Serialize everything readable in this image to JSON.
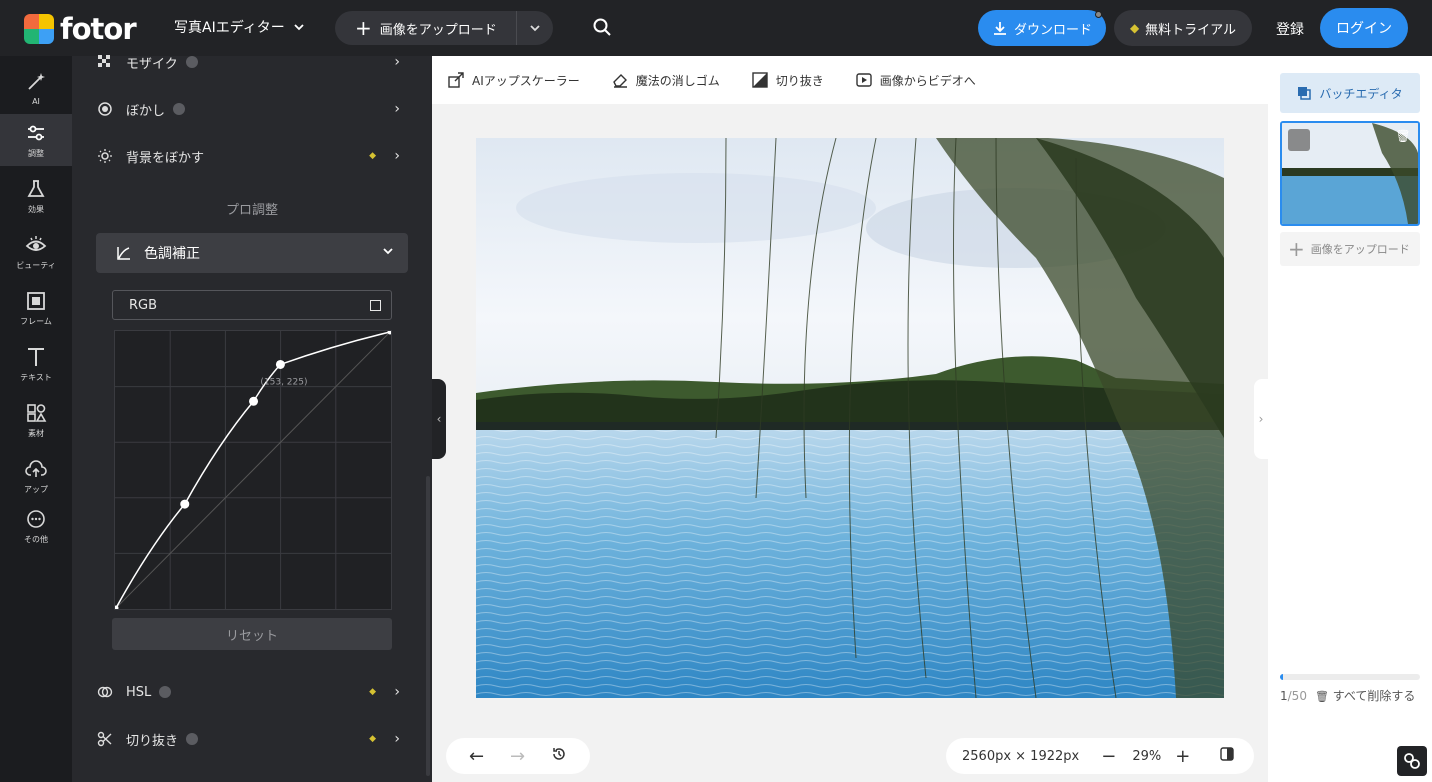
{
  "header": {
    "logo_text": "fotor",
    "editor_label": "写真AIエディター",
    "upload_label": "画像をアップロード",
    "download_label": "ダウンロード",
    "trial_label": "無料トライアル",
    "register_label": "登録",
    "login_label": "ログイン"
  },
  "rail": {
    "items": [
      {
        "label": "AI",
        "icon": "ai-sparkle-icon"
      },
      {
        "label": "調整",
        "icon": "sliders-icon",
        "active": true
      },
      {
        "label": "効果",
        "icon": "flask-icon"
      },
      {
        "label": "ビューティ",
        "icon": "eye-icon"
      },
      {
        "label": "フレーム",
        "icon": "frame-icon"
      },
      {
        "label": "テキスト",
        "icon": "text-icon"
      },
      {
        "label": "素材",
        "icon": "elements-icon"
      },
      {
        "label": "アップ",
        "icon": "cloud-upload-icon"
      },
      {
        "label": "その他",
        "icon": "more-icon"
      }
    ]
  },
  "panel": {
    "mosaic": "モザイク",
    "blur": "ぼかし",
    "bg_blur": "背景をぼかす",
    "pro_section": "プロ調整",
    "curves": "色調補正",
    "channel": "RGB",
    "point_label": "(153, 225)",
    "reset": "リセット",
    "hsl": "HSL",
    "crop": "切り抜き"
  },
  "curve": {
    "points": [
      [
        0,
        0
      ],
      [
        64,
        64
      ],
      [
        128,
        128
      ],
      [
        153,
        225
      ],
      [
        255,
        255
      ]
    ],
    "curve_points": [
      [
        0,
        0
      ],
      [
        64,
        96
      ],
      [
        128,
        191
      ],
      [
        153,
        225
      ],
      [
        255,
        255
      ]
    ]
  },
  "workspace": {
    "tools": [
      {
        "label": "AIアップスケーラー",
        "icon": "upscale-icon"
      },
      {
        "label": "魔法の消しゴム",
        "icon": "eraser-icon"
      },
      {
        "label": "切り抜き",
        "icon": "cutout-icon"
      },
      {
        "label": "画像からビデオへ",
        "icon": "video-icon"
      }
    ],
    "dimensions": "2560px × 1922px",
    "zoom": "29%"
  },
  "right": {
    "batch_label": "バッチエディタ",
    "upload_label": "画像をアップロード",
    "count_current": "1",
    "count_total": "/50",
    "delete_all": "すべて削除する",
    "progress": 0.02
  },
  "colors": {
    "accent": "#2a8cef",
    "gem": "#d6c232"
  }
}
